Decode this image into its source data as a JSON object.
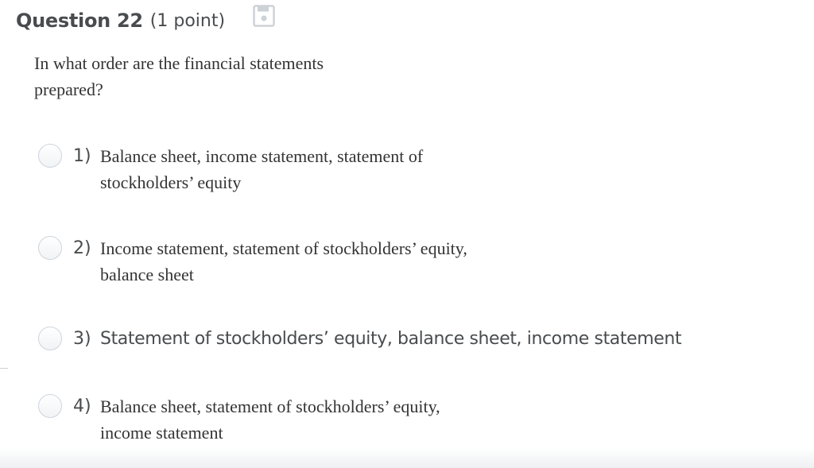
{
  "question": {
    "title": "Question 22",
    "points": "(1 point)",
    "text": "In what order are the financial statements prepared?"
  },
  "icons": {
    "save": "floppy-disk-icon"
  },
  "options": [
    {
      "number": "1)",
      "text": "Balance sheet, income statement, statement of stockholders’ equity"
    },
    {
      "number": "2)",
      "text": "Income statement, statement of stockholders’ equity, balance sheet"
    },
    {
      "number": "3)",
      "text": "Statement of stockholders’ equity, balance sheet, income statement"
    },
    {
      "number": "4)",
      "text": "Balance sheet, statement of stockholders’ equity, income statement"
    }
  ],
  "colors": {
    "text": "#494c4e",
    "radio_border": "#cdd5dc",
    "icon": "#cdd2d7"
  }
}
